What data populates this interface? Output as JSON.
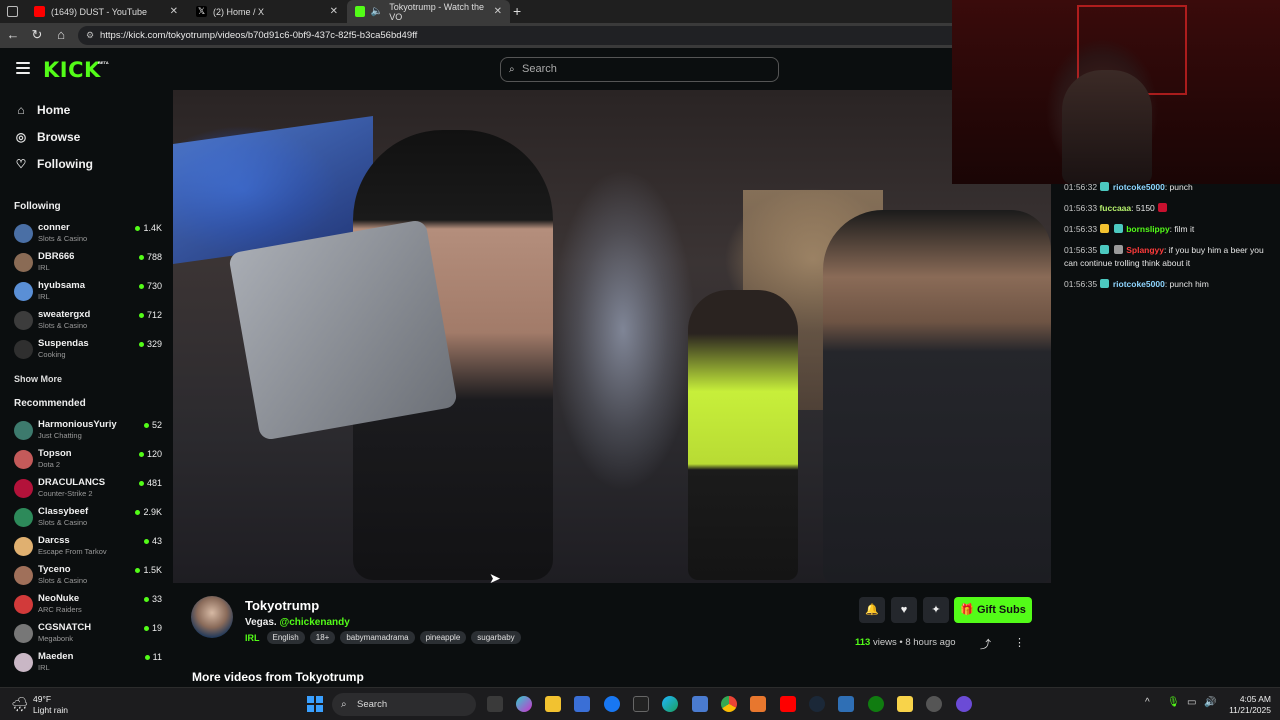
{
  "browser": {
    "tabs": [
      {
        "title": "(1649) DUST - YouTube"
      },
      {
        "title": "(2) Home / X"
      },
      {
        "title": "Tokyotrump - Watch the VO"
      }
    ],
    "url": "https://kick.com/tokyotrump/videos/b70d91c6-0bf9-437c-82f5-b3ca56bd49ff"
  },
  "header": {
    "logo": "KICK",
    "logo_badge": "BETA",
    "search_placeholder": "Search"
  },
  "sidebar": {
    "nav": [
      {
        "label": "Home",
        "icon": "home-icon"
      },
      {
        "label": "Browse",
        "icon": "compass-icon"
      },
      {
        "label": "Following",
        "icon": "heart-icon"
      }
    ],
    "following_title": "Following",
    "following": [
      {
        "name": "conner",
        "category": "Slots & Casino",
        "viewers": "1.4K"
      },
      {
        "name": "DBR666",
        "category": "IRL",
        "viewers": "788"
      },
      {
        "name": "hyubsama",
        "category": "IRL",
        "viewers": "730"
      },
      {
        "name": "sweatergxd",
        "category": "Slots & Casino",
        "viewers": "712"
      },
      {
        "name": "Suspendas",
        "category": "Cooking",
        "viewers": "329"
      }
    ],
    "show_more": "Show More",
    "recommended_title": "Recommended",
    "recommended": [
      {
        "name": "HarmoniousYuriy",
        "category": "Just Chatting",
        "viewers": "52"
      },
      {
        "name": "Topson",
        "category": "Dota 2",
        "viewers": "120"
      },
      {
        "name": "DRACULANCS",
        "category": "Counter-Strike 2",
        "viewers": "481"
      },
      {
        "name": "Classybeef",
        "category": "Slots & Casino",
        "viewers": "2.9K"
      },
      {
        "name": "Darcss",
        "category": "Escape From Tarkov",
        "viewers": "43"
      },
      {
        "name": "Tyceno",
        "category": "Slots & Casino",
        "viewers": "1.5K"
      },
      {
        "name": "NeoNuke",
        "category": "ARC Raiders",
        "viewers": "33"
      },
      {
        "name": "CGSNATCH",
        "category": "Megabonk",
        "viewers": "19"
      },
      {
        "name": "Maeden",
        "category": "IRL",
        "viewers": "11"
      }
    ]
  },
  "chat": {
    "messages": [
      {
        "time": "01:56:32",
        "user": "riotcoke5000",
        "user_color": "#8fd6ff",
        "text": ": punch"
      },
      {
        "time": "01:56:33",
        "user": "fuccaaa",
        "user_color": "#b5f06c",
        "text": ": 5150"
      },
      {
        "time": "01:56:33",
        "user": "bornslippy",
        "user_color": "#53fc18",
        "text": ": film it"
      },
      {
        "time": "01:56:35",
        "user": "Splangyy",
        "user_color": "#ff3b3b",
        "text": ": if you buy him a beer you can continue trolling think about it"
      },
      {
        "time": "01:56:35",
        "user": "riotcoke5000",
        "user_color": "#8fd6ff",
        "text": ": punch him"
      }
    ]
  },
  "stream": {
    "streamer": "Tokyotrump",
    "title_prefix": "Vegas. ",
    "title_mention": "@chickenandy",
    "category": "IRL",
    "tags": [
      "English",
      "18+",
      "babymamadrama",
      "pineapple",
      "sugarbaby"
    ],
    "views_count": "113",
    "views_label": "views",
    "time_ago": "8 hours ago",
    "gift_subs_label": "Gift Subs",
    "more_videos": "More videos from Tokyotrump"
  },
  "taskbar": {
    "temperature": "49°F",
    "condition": "Light rain",
    "search_label": "Search",
    "time": "4:05 AM",
    "date": "11/21/2025"
  },
  "colors": {
    "accent": "#53fc18",
    "background": "#0b0e0f"
  }
}
